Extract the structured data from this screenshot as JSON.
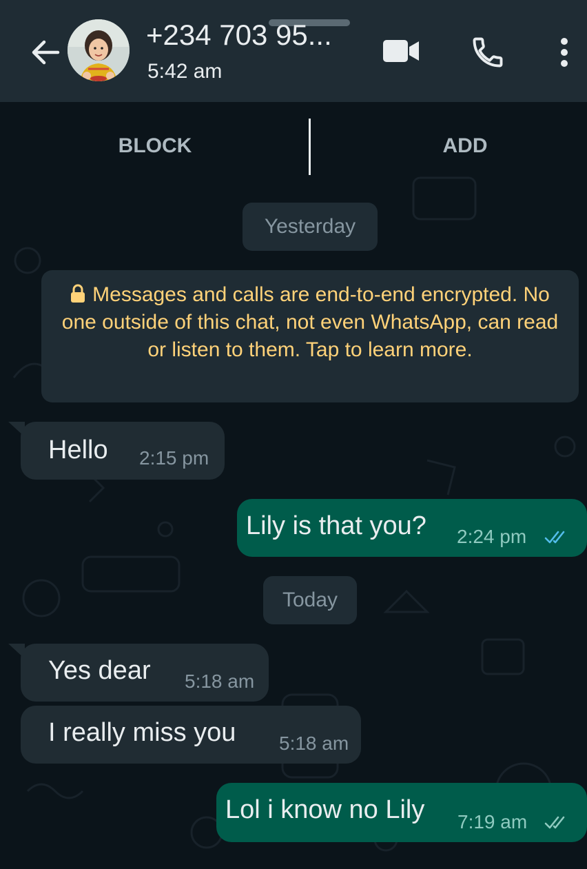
{
  "header": {
    "contact_name": "+234 703 95...",
    "last_seen": "5:42 am"
  },
  "actions": {
    "block_label": "BLOCK",
    "add_label": "ADD"
  },
  "chat": {
    "date_yesterday": "Yesterday",
    "encryption_notice": "Messages and calls are end-to-end encrypted. No one outside of this chat, not even WhatsApp, can read or listen to them. Tap to learn more.",
    "date_today": "Today",
    "messages": [
      {
        "direction": "incoming",
        "text": "Hello",
        "time": "2:15 pm"
      },
      {
        "direction": "outgoing",
        "text": "Lily is that you?",
        "time": "2:24 pm",
        "status": "read",
        "status_color": "#53bdeb"
      },
      {
        "direction": "incoming",
        "text": "Yes dear",
        "time": "5:18 am"
      },
      {
        "direction": "incoming",
        "text": "I really miss you",
        "time": "5:18 am"
      },
      {
        "direction": "outgoing",
        "text": "Lol i know no Lily",
        "time": "7:19 am",
        "status": "delivered",
        "status_color": "#8fcac0"
      }
    ]
  },
  "colors": {
    "header_bg": "#1f2c34",
    "chat_bg": "#0b141a",
    "incoming_bubble": "#202c33",
    "outgoing_bubble": "#005c4b",
    "notice_text": "#ffd279"
  }
}
